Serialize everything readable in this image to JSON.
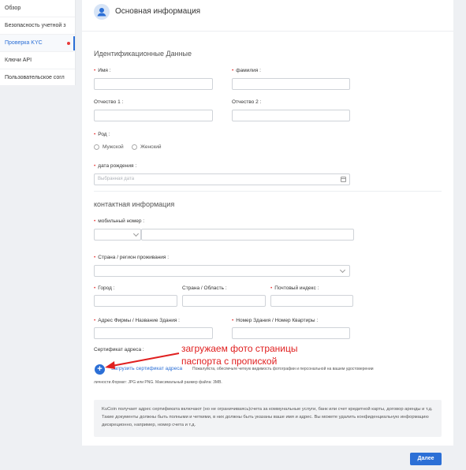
{
  "nav": {
    "items": [
      {
        "label": "Обзор"
      },
      {
        "label": "Безопасность учетной з"
      },
      {
        "label": "Проверка KYC"
      },
      {
        "label": "Ключи API"
      },
      {
        "label": "Пользовательское согл"
      }
    ]
  },
  "header": {
    "title": "Основная информация"
  },
  "identity": {
    "section_title": "Идентификационные Данные",
    "name_label": "Имя :",
    "surname_label": "фамилия :",
    "patronymic1_label": "Отчество 1 :",
    "patronymic2_label": "Отчество 2 :",
    "gender_label": "Род :",
    "gender_male": "Мужской",
    "gender_female": "Женский",
    "dob_label": "дата рождения :",
    "dob_placeholder": "Выбранная дата"
  },
  "contact": {
    "section_title": "контактная информация",
    "phone_label": "мобильный номер :",
    "country_label": "Страна / регион проживания :",
    "city_label": "Город :",
    "state_label": "Страна / Область :",
    "zip_label": "Почтовый индекс :",
    "address_label": "Адрес Фирмы / Название Здания :",
    "building_label": "Номер Здания / Номер Квартиры :",
    "cert_label": "Сертификат адреса :",
    "upload_label": "Загрузить сертификат адреса",
    "upload_hint": "Пожалуйста, обеспечьте четкую видимость фотографии и персональной на вашем удостоверении",
    "upload_hint2": "личности.Формат: JPG или PNG. Максимальный размер файла: 3MB."
  },
  "annotation": {
    "text": "загружаем фото страницы паспорта с пропиской"
  },
  "note": {
    "text": "KuCoin получает адрес сертификата включают (но не ограничиваясь)счета за коммунальные услуги, банк или счет кредитной карты, договор аренды и т.д. Такие документы должны быть полными и четкими, в них должны быть указаны ваше имя и адрес. Вы можете удалить конфиденциальную информацию дискреционно, например, номер счета и т.д."
  },
  "footer": {
    "next_label": "Далее"
  },
  "colors": {
    "accent": "#2b6fd6",
    "required": "#e83a3a",
    "annotation": "#e02020"
  }
}
